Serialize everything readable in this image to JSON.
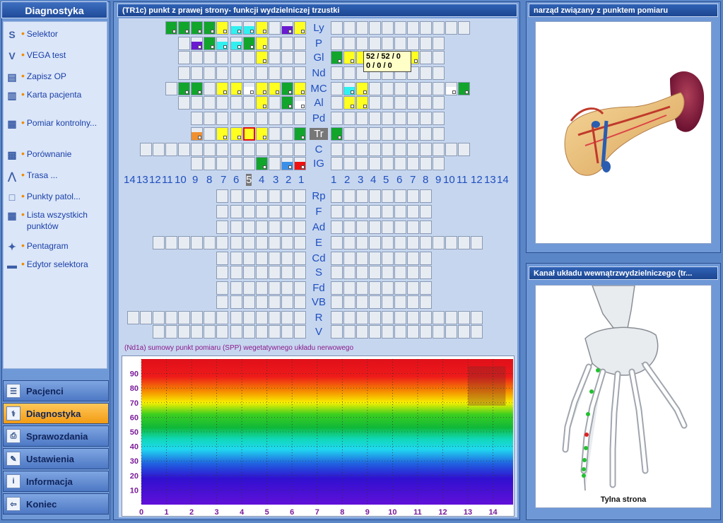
{
  "sidebar": {
    "title": "Diagnostyka",
    "items": [
      {
        "label": "Selektor",
        "icon": "s-letter-icon"
      },
      {
        "label": "VEGA test",
        "icon": "v-letter-icon"
      },
      {
        "label": "Zapisz OP",
        "icon": "save-document-icon"
      },
      {
        "label": "Karta pacjenta",
        "icon": "book-icon"
      },
      {
        "label": "Pomiar kontrolny...",
        "icon": "chart-icon"
      },
      {
        "label": "Porównanie",
        "icon": "compare-grid-icon"
      },
      {
        "label": "Trasa ...",
        "icon": "path-icon"
      },
      {
        "label": "Punkty patol...",
        "icon": "square-icon"
      },
      {
        "label": "Lista wszystkich punktów",
        "icon": "list-grid-icon"
      },
      {
        "label": "Pentagram",
        "icon": "pentagram-icon"
      },
      {
        "label": "Edytor selektora",
        "icon": "folder-icon"
      }
    ],
    "nav": [
      {
        "label": "Pacjenci",
        "icon": "patients-icon",
        "active": false
      },
      {
        "label": "Diagnostyka",
        "icon": "diagnostics-icon",
        "active": true
      },
      {
        "label": "Sprawozdania",
        "icon": "printer-icon",
        "active": false
      },
      {
        "label": "Ustawienia",
        "icon": "tools-icon",
        "active": false
      },
      {
        "label": "Informacja",
        "icon": "info-icon",
        "active": false
      },
      {
        "label": "Koniec",
        "icon": "exit-icon",
        "active": false
      }
    ]
  },
  "center": {
    "title": "(TR1c)  punkt  z prawej strony- funkcji wydzielniczej trzustki",
    "meridians_top": [
      "Ly",
      "P",
      "Gl",
      "Nd",
      "MC",
      "Al",
      "Pd",
      "Tr",
      "C",
      "IG"
    ],
    "meridians_bottom": [
      "Rp",
      "F",
      "Ad",
      "E",
      "Cd",
      "S",
      "Fd",
      "VB",
      "R",
      "V"
    ],
    "selected_meridian": "Tr",
    "numbers_left": [
      "14",
      "13",
      "12",
      "11",
      "10",
      "9",
      "8",
      "7",
      "6",
      "5",
      "4",
      "3",
      "2",
      "1"
    ],
    "numbers_right": [
      "1",
      "2",
      "3",
      "4",
      "5",
      "6",
      "7",
      "8",
      "9",
      "10",
      "11",
      "12",
      "13",
      "14"
    ],
    "selected_number": "5",
    "tooltip_line1": "52 / 52 / 0",
    "tooltip_line2": "0 / 0 / 0",
    "spp_label": "(Nd1a)   sumowy punkt pomiaru (SPP) wegetatywnego układu nerwowego",
    "colors": {
      "green": "#12a52c",
      "yellow": "#ffff20",
      "cyan": "#30f0f0",
      "purple": "#6a1ad0",
      "orange": "#f09030",
      "blue": "#3a90e8",
      "red": "#f01010",
      "white": "#ffffff"
    }
  },
  "chart_data": {
    "type": "heatmap",
    "title": "",
    "xlabel": "",
    "ylabel": "",
    "x_ticks": [
      "0",
      "1",
      "2",
      "3",
      "4",
      "5",
      "6",
      "7",
      "8",
      "9",
      "10",
      "11",
      "12",
      "13",
      "14"
    ],
    "y_ticks": [
      "90",
      "80",
      "70",
      "60",
      "50",
      "40",
      "30",
      "20",
      "10"
    ],
    "xlim": [
      0,
      14.8
    ],
    "ylim": [
      0,
      100
    ],
    "highlight": {
      "x_start": 13,
      "x_end": 14.5,
      "y_start": 68,
      "y_end": 95
    }
  },
  "right_top": {
    "title": "narząd związany z punktem pomiaru"
  },
  "right_bottom": {
    "title": "Kanał układu wewnątrzwydzielniczego (tr...",
    "caption": "Tylna strona"
  }
}
